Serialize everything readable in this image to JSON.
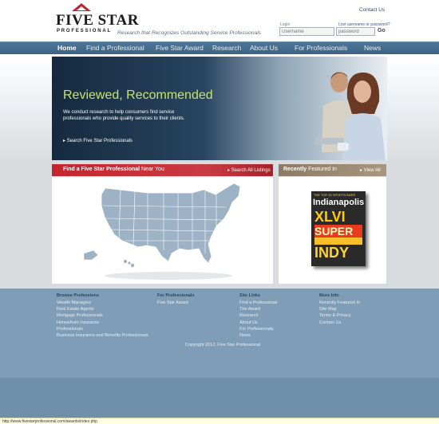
{
  "header": {
    "logo_name": "FIVE STAR",
    "logo_sub": "PROFESSIONAL",
    "tagline": "Research that Recognizes Outstanding Service Professionals",
    "contact_link": "Contact Us",
    "login_label": "Login",
    "forgot_link": "Lost username or password?",
    "username_placeholder": "Username",
    "password_placeholder": "password",
    "go_label": "Go"
  },
  "nav": {
    "items": [
      "Home",
      "Find a Professional",
      "Five Star Award",
      "Research",
      "About Us",
      "For Professionals",
      "News"
    ],
    "active": "Home"
  },
  "hero": {
    "title": "Reviewed, Recommended",
    "description": "We conduct research to help consumers find service professionals who provide quality services to their clients.",
    "cta": "Search Five Star Professionals"
  },
  "find": {
    "title_bold": "Find a Five Star Professional",
    "title_light": " Near You",
    "search_all": "Search All Listings"
  },
  "featured": {
    "title_bold": "Recently",
    "title_light": " Featured In",
    "view_all": "View All",
    "magazine": {
      "topline": "THE TOP 20 SPORTS BARS",
      "city": "Indianapolis",
      "line1": "XLVI",
      "line2": "SUPER",
      "line3": "INDY"
    }
  },
  "footer": {
    "columns": [
      {
        "heading": "Browse Professions",
        "items": [
          "Wealth Managers",
          "Real Estate Agents",
          "Mortgage Professionals",
          "Home/Auto Insurance",
          "Professionals",
          "Business Insurance and Benefits Professionals"
        ]
      },
      {
        "heading": "For Professionals",
        "items": [
          "Five Star Award"
        ]
      },
      {
        "heading": "Site Links",
        "items": [
          "Find a Professional",
          "The Award",
          "Research",
          "About Us",
          "For Professionals",
          "News"
        ]
      },
      {
        "heading": "More Info",
        "items": [
          "Recently Featured In",
          "Site Map",
          "Terms & Privacy",
          "Contact Us"
        ]
      }
    ],
    "copyright": "Copyright 2012, Five Star Professional"
  },
  "status_bar": "http://www.fivestarprofessional.com/awards/index.php",
  "colors": {
    "nav_blue": "#3c6385",
    "accent_red": "#c4262e",
    "hero_green": "#c8e26b",
    "featured_tan": "#8b7a66",
    "footer_blue": "#7f9db6"
  }
}
